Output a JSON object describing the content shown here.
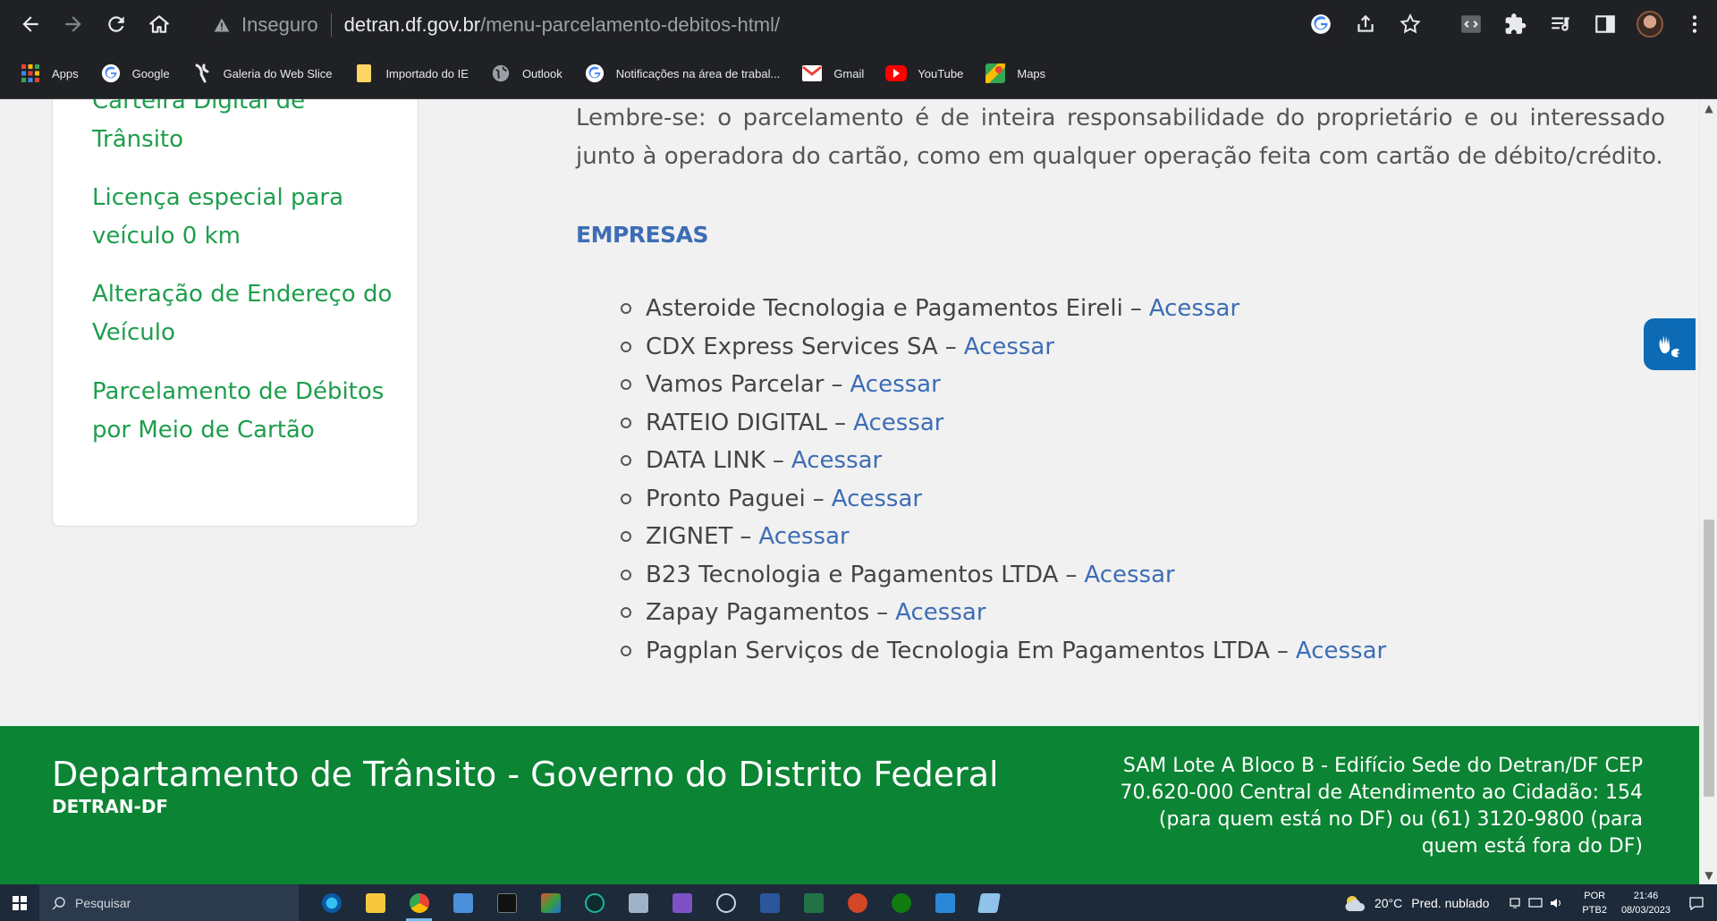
{
  "browser": {
    "security_label": "Inseguro",
    "url_host": "detran.df.gov.br",
    "url_path": "/menu-parcelamento-debitos-html/"
  },
  "bookmarks": [
    {
      "label": "Apps",
      "icon": "apps-grid-icon"
    },
    {
      "label": "Google",
      "icon": "google-icon"
    },
    {
      "label": "Galeria do Web Slice",
      "icon": "web-slice-icon"
    },
    {
      "label": "Importado do IE",
      "icon": "folder-icon"
    },
    {
      "label": "Outlook",
      "icon": "globe-icon"
    },
    {
      "label": "Notificações na área de trabal...",
      "icon": "google-icon"
    },
    {
      "label": "Gmail",
      "icon": "gmail-icon"
    },
    {
      "label": "YouTube",
      "icon": "youtube-icon"
    },
    {
      "label": "Maps",
      "icon": "maps-icon"
    }
  ],
  "sidebar": {
    "links": [
      {
        "line1": "Carteira Digital de",
        "line2": "Trânsito"
      },
      {
        "line1": "Licença especial para",
        "line2": "veículo 0 km"
      },
      {
        "line1": "Alteração de Endereço do",
        "line2": "Veículo"
      },
      {
        "line1": "Parcelamento de Débitos",
        "line2": "por Meio de Cartão"
      }
    ]
  },
  "content": {
    "lembre": "Lembre-se: o parcelamento é de inteira responsabilidade do proprietário e ou interessado junto à operadora do cartão, como em qualquer operação feita com cartão de débito/crédito.",
    "section_title": "EMPRESAS",
    "companies": [
      {
        "name": "Asteroide Tecnologia e Pagamentos Eireli",
        "link": "Acessar"
      },
      {
        "name": "CDX Express Services SA",
        "link": "Acessar"
      },
      {
        "name": "Vamos Parcelar",
        "link": "Acessar"
      },
      {
        "name": "RATEIO DIGITAL",
        "link": "Acessar"
      },
      {
        "name": "DATA LINK",
        "link": "Acessar"
      },
      {
        "name": "Pronto Paguei",
        "link": "Acessar"
      },
      {
        "name": "ZIGNET",
        "link": "Acessar"
      },
      {
        "name": "B23 Tecnologia e Pagamentos LTDA",
        "link": "Acessar"
      },
      {
        "name": "Zapay Pagamentos",
        "link": "Acessar"
      },
      {
        "name": "Pagplan Serviços de Tecnologia Em Pagamentos LTDA",
        "link": "Acessar"
      }
    ],
    "dash": "–"
  },
  "footer": {
    "title": "Departamento de Trânsito - Governo do Distrito Federal",
    "subtitle": "DETRAN-DF",
    "address": "SAM Lote A Bloco B - Edifício Sede do Detran/DF CEP 70.620-000 Central de Atendimento ao Cidadão: 154 (para quem está no DF) ou (61) 3120-9800 (para quem está fora do DF)"
  },
  "taskbar": {
    "search_placeholder": "Pesquisar",
    "weather_temp": "20°C",
    "weather_desc": "Pred. nublado",
    "lang_line1": "POR",
    "lang_line2": "PTB2",
    "time": "21:46",
    "date": "08/03/2023"
  },
  "colors": {
    "link_green": "#1e9e4c",
    "link_blue": "#3d6db5",
    "footer_green": "#0b8433"
  }
}
